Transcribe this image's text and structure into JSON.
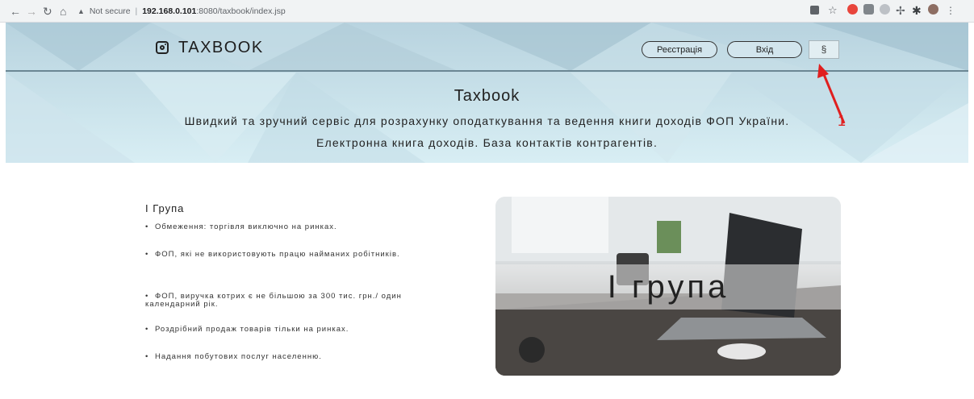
{
  "browser": {
    "back_icon": "←",
    "forward_icon": "→",
    "reload_icon": "↻",
    "home_icon": "⌂",
    "security_icon": "▲",
    "security_text": "Not secure",
    "url_host": "192.168.0.101",
    "url_path": ":8080/taxbook/index.jsp"
  },
  "header": {
    "brand": "TAXBOOK",
    "register_label": "Реєстрація",
    "login_label": "Вхід",
    "section_label": "§"
  },
  "hero": {
    "title": "Taxbook",
    "subtitle_1": "Швидкий та зручний сервіс для розрахунку оподаткування та ведення книги доходів ФОП України.",
    "subtitle_2": "Електронна книга доходів. База контактів контрагентів."
  },
  "annotation": {
    "number": "1",
    "color": "#e01f1f"
  },
  "group": {
    "title": "І Група",
    "items": [
      "Обмеження: торгівля виключно на ринках.",
      "ФОП, які не використовують працю найманих робітників.",
      "ФОП, виручка котрих є не більшою за 300 тис. грн./ один календарний рік.",
      "Роздрібний продаж товарів тільки на ринках.",
      "Надання побутових послуг населенню."
    ],
    "image_caption": "І група"
  }
}
